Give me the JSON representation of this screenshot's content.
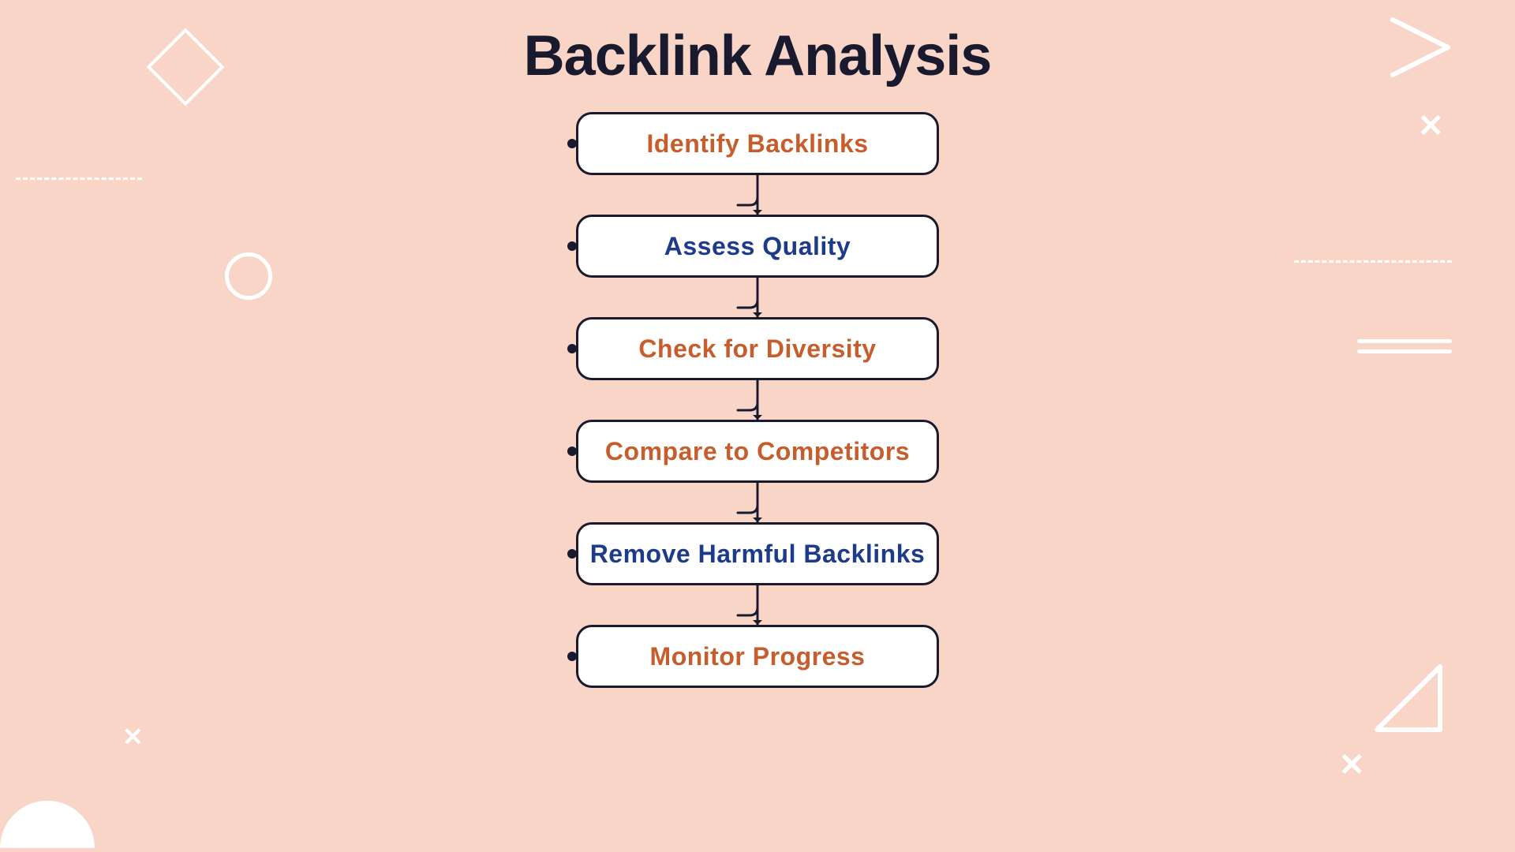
{
  "page": {
    "title": "Backlink Analysis",
    "background_color": "#f9d5c8"
  },
  "flowchart": {
    "steps": [
      {
        "id": "step-1",
        "label": "Identify Backlinks",
        "color_class": "color-orange"
      },
      {
        "id": "step-2",
        "label": "Assess Quality",
        "color_class": "color-navy"
      },
      {
        "id": "step-3",
        "label": "Check for Diversity",
        "color_class": "color-orange"
      },
      {
        "id": "step-4",
        "label": "Compare to Competitors",
        "color_class": "color-orange"
      },
      {
        "id": "step-5",
        "label": "Remove Harmful Backlinks",
        "color_class": "color-navy"
      },
      {
        "id": "step-6",
        "label": "Monitor Progress",
        "color_class": "color-orange"
      }
    ]
  },
  "decorations": {
    "diamond_label": "diamond",
    "chevron_label": "chevron",
    "x_label": "x-mark",
    "circle_label": "circle",
    "dashed_label": "dashed-line"
  }
}
